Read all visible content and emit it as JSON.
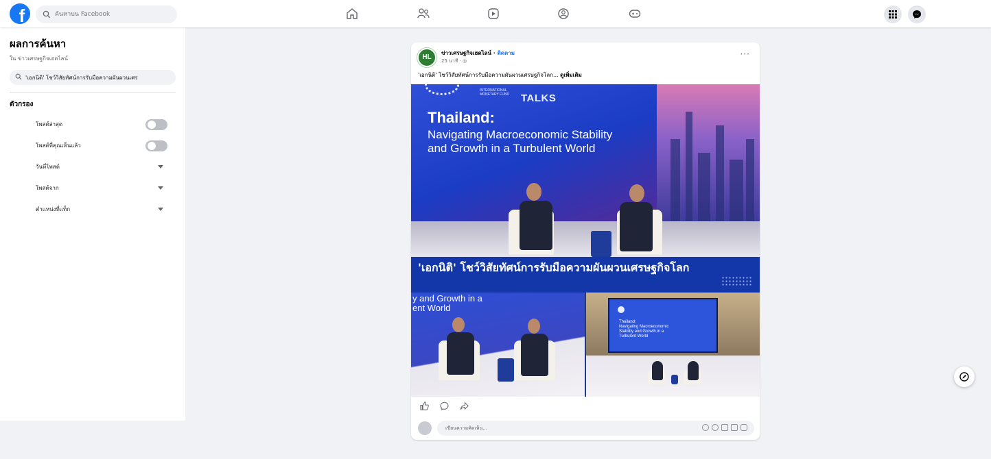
{
  "topbar": {
    "logo_letter": "f",
    "search_placeholder": "ค้นหาบน Facebook"
  },
  "sidebar": {
    "title": "ผลการค้นหา",
    "subtitle": "ใน ข่าวเศรษฐกิจเฮดไลน์",
    "query": "'เอกนิติ' โชว์วิสัยทัศน์การรับมือความผันผวนเศร",
    "filters_title": "ตัวกรอง",
    "filters": [
      {
        "label": "โพสต์ล่าสุด",
        "control": "toggle",
        "on": false
      },
      {
        "label": "โพสต์ที่คุณเห็นแล้ว",
        "control": "toggle",
        "on": false
      },
      {
        "label": "วันที่โพสต์",
        "control": "dropdown"
      },
      {
        "label": "โพสต์จาก",
        "control": "dropdown"
      },
      {
        "label": "ตำแหน่งที่แท็ก",
        "control": "dropdown"
      }
    ]
  },
  "post": {
    "avatar_text": "HL",
    "page_name": "ข่าวเศรษฐกิจเฮดไลน์",
    "separator": " · ",
    "follow_label": "ติดตาม",
    "time": "25 นาที · ◎",
    "more_label": "···",
    "caption": "'เอกนิติ' โชว์วิสัยทัศน์การรับมือความผันผวนเศรษฐกิจโลก...",
    "see_more": "ดูเพิ่มเติม",
    "image": {
      "gov_small_1": "INTERNATIONAL",
      "gov_small_2": "MONETARY FUND",
      "gov_big": "TALKS",
      "title_1": "Thailand:",
      "title_2": "Navigating Macroeconomic Stability and Growth in a Turbulent World",
      "banner": "'เอกนิติ' โชว์วิสัยทัศน์การรับมือความผันผวนเศรษฐกิจโลก",
      "thumb_left_title": "y and Growth in a\nent World",
      "thumb_right_title": "Thailand:\nNavigating Macroeconomic\nStability and Growth in a\nTurbulent World"
    },
    "comment_placeholder": "เขียนความคิดเห็น..."
  },
  "colors": {
    "brand": "#1877f2",
    "banner": "#1336a8",
    "page_bg": "#f0f2f5"
  }
}
